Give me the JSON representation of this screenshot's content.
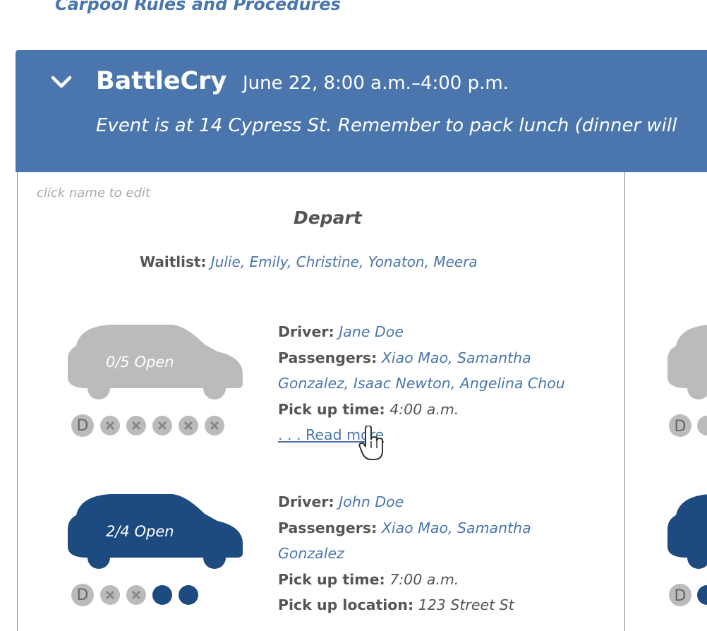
{
  "header_link": "Carpool Rules and Procedures",
  "event": {
    "title": "BattleCry",
    "date": "June 22, 8:00 a.m.–4:00 p.m.",
    "description": "Event is at 14 Cypress St. Remember to pack lunch (dinner will"
  },
  "depart": {
    "hint": "click name to edit",
    "title": "Depart",
    "waitlist_label": "Waitlist:",
    "waitlist_names": "Julie, Emily, Christine, Yonaton, Meera",
    "cars": [
      {
        "open": "0/5 Open",
        "seats": [
          "D",
          "x",
          "x",
          "x",
          "x",
          "x"
        ],
        "driver_label": "Driver:",
        "driver": "Jane Doe",
        "passengers_label": "Passengers:",
        "passengers_line1": "Xiao Mao, Samantha",
        "passengers_line2": "Gonzalez, Isaac Newton, Angelina Chou",
        "pickup_time_label": "Pick up time:",
        "pickup_time": "4:00 a.m.",
        "read_more": ". . . Read more"
      },
      {
        "open": "2/4 Open",
        "seats": [
          "D",
          "x",
          "x",
          "filled",
          "filled"
        ],
        "driver_label": "Driver:",
        "driver": "John Doe",
        "passengers_label": "Passengers:",
        "passengers_line1": "Xiao Mao, Samantha",
        "passengers_line2": "Gonzalez",
        "pickup_time_label": "Pick up time:",
        "pickup_time": "7:00 a.m.",
        "pickup_location_label": "Pick up location:",
        "pickup_location": "123 Street St"
      }
    ]
  },
  "colors": {
    "header_bg": "#4a76ad",
    "car_open": "#bbbbbb",
    "car_filled": "#1d4a7f",
    "link": "#4a76ad"
  },
  "icons": [
    "chevron-down-icon",
    "car-icon",
    "driver-seat-icon",
    "seat-taken-icon",
    "seat-open-icon",
    "hand-cursor-icon"
  ]
}
